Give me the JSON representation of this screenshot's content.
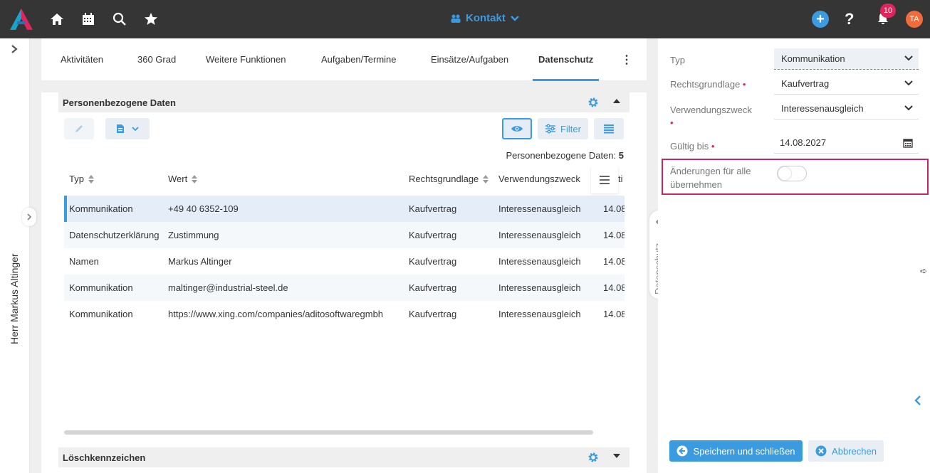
{
  "header": {
    "context_label": "Kontakt",
    "notification_count": "10",
    "user_initials": "TA",
    "help_label": "?"
  },
  "left_rail": {
    "title": "Herr Markus Altinger"
  },
  "tabs": [
    {
      "label": "Aktivitäten"
    },
    {
      "label": "360 Grad"
    },
    {
      "label": "Weitere Funktionen"
    },
    {
      "label": "Aufgaben/Termine"
    },
    {
      "label": "Einsätze/Aufgaben"
    },
    {
      "label": "Datenschutz"
    }
  ],
  "section": {
    "title": "Personenbezogene Daten",
    "filter_label": "Filter",
    "count_label": "Personenbezogene Daten:",
    "count_value": "5"
  },
  "table": {
    "columns": [
      "Typ",
      "Wert",
      "Rechtsgrundlage",
      "Verwendungszweck",
      "ti"
    ],
    "rows": [
      [
        "Kommunikation",
        "+49 40 6352-109",
        "Kaufvertrag",
        "Interessenausgleich",
        "14.08"
      ],
      [
        "Datenschutzerklärung",
        "Zustimmung",
        "Kaufvertrag",
        "Interessenausgleich",
        "14.08"
      ],
      [
        "Namen",
        "Markus Altinger",
        "Kaufvertrag",
        "Interessenausgleich",
        "14.08"
      ],
      [
        "Kommunikation",
        "maltinger@industrial-steel.de",
        "Kaufvertrag",
        "Interessenausgleich",
        "14.08"
      ],
      [
        "Kommunikation",
        "https://www.xing.com/companies/aditosoftwaregmbh",
        "Kaufvertrag",
        "Interessenausgleich",
        "14.08"
      ]
    ]
  },
  "section2": {
    "title": "Löschkennzeichen"
  },
  "side_tab": {
    "label": "Datenschutz"
  },
  "form": {
    "typ_label": "Typ",
    "typ_value": "Kommunikation",
    "rechtsgrundlage_label": "Rechtsgrundlage",
    "rechtsgrundlage_value": "Kaufvertrag",
    "verwendungszweck_label": "Verwendungszweck",
    "verwendungszweck_value": "Interessenausgleich",
    "gueltig_label": "Gültig bis",
    "gueltig_value": "14.08.2027",
    "aenderungen_label_1": "Änderungen für alle",
    "aenderungen_label_2": "übernehmen",
    "required_marker": "•",
    "save_label": "Speichern und schließen",
    "cancel_label": "Abbrechen"
  },
  "colors": {
    "accent": "#3a9be0",
    "topbar": "#353535",
    "badge": "#e0245e",
    "highlight": "#c8226c",
    "avatar": "#f26b3a"
  }
}
